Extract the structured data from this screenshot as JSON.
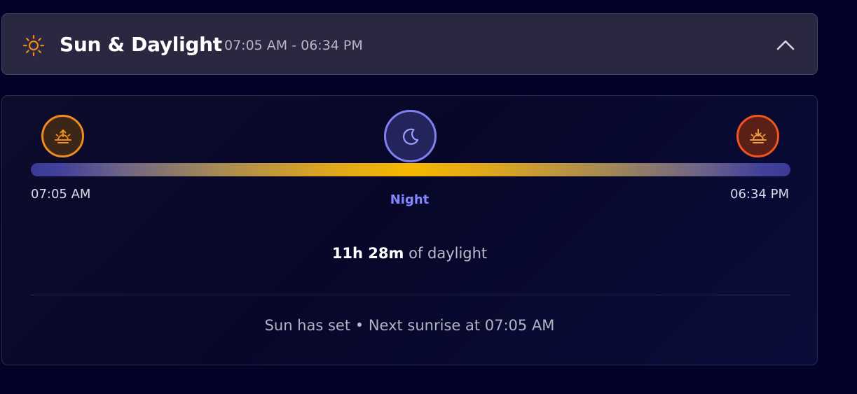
{
  "header": {
    "title": "Sun & Daylight",
    "time_range": "07:05 AM - 06:34 PM",
    "sun_icon": "sun-icon",
    "toggle_icon": "chevron-up-icon"
  },
  "timeline": {
    "sunrise_icon": "sunrise-icon",
    "sunset_icon": "sunset-icon",
    "phase_icon": "moon-icon",
    "sunrise_time": "07:05 AM",
    "sunset_time": "06:34 PM",
    "phase_label": "Night"
  },
  "daylight": {
    "duration": "11h 28m",
    "suffix": " of daylight"
  },
  "status": {
    "text": "Sun has set • Next sunrise at 07:05 AM"
  },
  "colors": {
    "background": "#03032a",
    "header_bg": "#2a2840",
    "sunrise_accent": "#f08a1c",
    "sunset_accent": "#f0531c",
    "moon_accent": "#7e80f2",
    "night_label": "#8486ff",
    "daylight_peak": "#f5b800"
  }
}
